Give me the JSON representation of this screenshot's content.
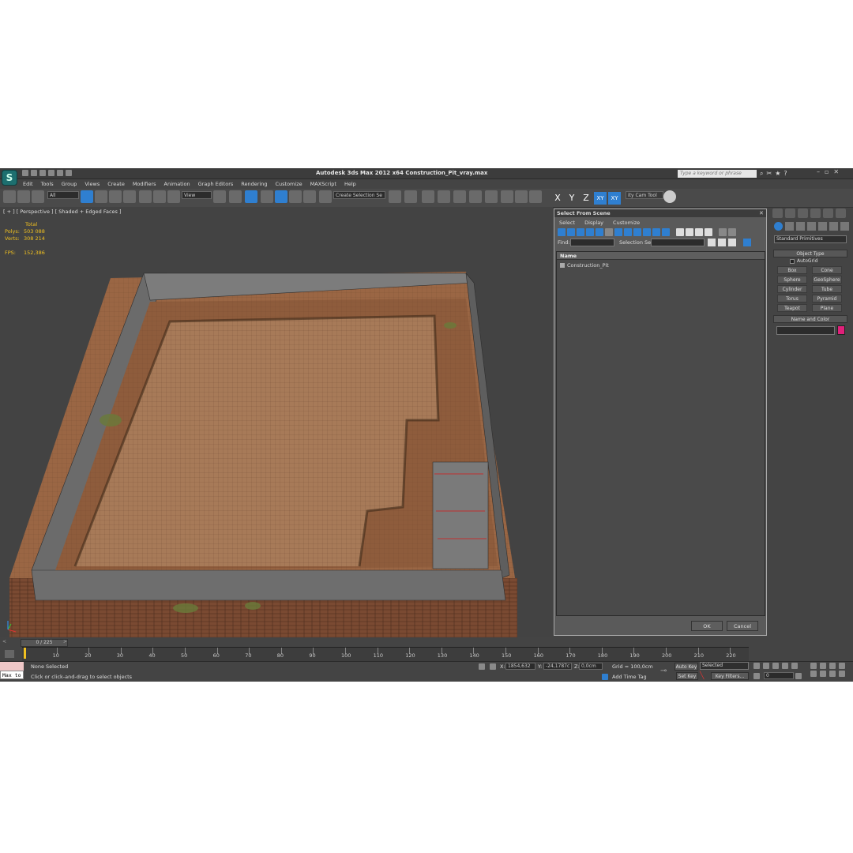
{
  "app": {
    "title": "Autodesk 3ds Max  2012 x64     Construction_Pit_vray.max",
    "search_placeholder": "Type a keyword or phrase",
    "logo_glyph": "S"
  },
  "menu": [
    "Edit",
    "Tools",
    "Group",
    "Views",
    "Create",
    "Modifiers",
    "Animation",
    "Graph Editors",
    "Rendering",
    "Customize",
    "MAXScript",
    "Help"
  ],
  "toolbar": {
    "filter_value": "All",
    "refcoord_value": "View",
    "selection_set_value": "Create Selection Se",
    "axis_x": "X",
    "axis_y": "Y",
    "axis_z": "Z",
    "axis_xy": "XY",
    "axis_xy2": "XY",
    "cam_tool": "ity Cam Tool"
  },
  "viewport": {
    "label": "[ + ] [ Perspective ] [ Shaded + Edged Faces ]",
    "stats_header": "Total",
    "polys_label": "Polys:",
    "polys_value": "503 088",
    "verts_label": "Verts:",
    "verts_value": "308 214",
    "fps_label": "FPS:",
    "fps_value": "152,386"
  },
  "dialog": {
    "title": "Select From Scene",
    "menu": [
      "Select",
      "Display",
      "Customize"
    ],
    "find_label": "Find:",
    "selset_label": "Selection Set:",
    "column_name": "Name",
    "items": [
      "Construction_Pit"
    ],
    "ok": "OK",
    "cancel": "Cancel"
  },
  "command_panel": {
    "category": "Standard Primitives",
    "object_type_header": "Object Type",
    "autogrid": "AutoGrid",
    "buttons": [
      "Box",
      "Cone",
      "Sphere",
      "GeoSphere",
      "Cylinder",
      "Tube",
      "Torus",
      "Pyramid",
      "Teapot",
      "Plane"
    ],
    "name_color_header": "Name and Color",
    "object_color": "#e0207a"
  },
  "timeline": {
    "slider": "0 / 225",
    "ticks": [
      "10",
      "20",
      "30",
      "40",
      "50",
      "60",
      "70",
      "80",
      "90",
      "100",
      "110",
      "120",
      "130",
      "140",
      "150",
      "160",
      "170",
      "180",
      "190",
      "200",
      "210",
      "220"
    ]
  },
  "status": {
    "maxscript": "Max to",
    "selection": "None Selected",
    "prompt": "Click or click-and-drag to select objects",
    "x_label": "X:",
    "x_value": "1854,632",
    "y_label": "Y:",
    "y_value": "-24,1787c",
    "z_label": "Z:",
    "z_value": "0,0cm",
    "grid": "Grid = 100,0cm",
    "add_time_tag": "Add Time Tag",
    "auto_key": "Auto Key",
    "selected_value": "Selected",
    "set_key": "Set Key",
    "key_filters": "Key Filters...",
    "frame_value": "0"
  }
}
